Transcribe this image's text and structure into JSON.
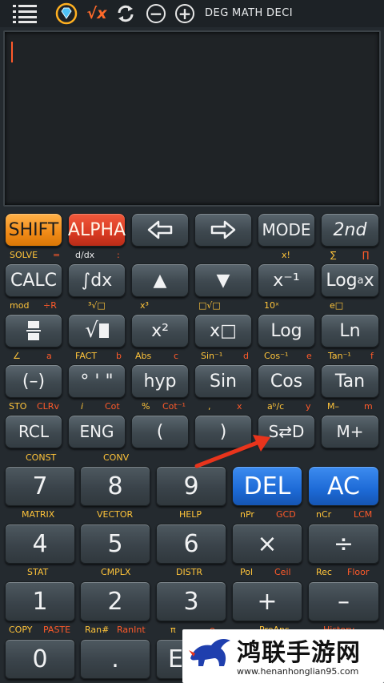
{
  "topbar": {
    "menu_icon": "hamburger-menu-icon",
    "items": [
      "DEG",
      "MATH",
      "DECI"
    ],
    "sqrt_label": "√x"
  },
  "display": {
    "value": ""
  },
  "row1": {
    "shift": "SHIFT",
    "alpha": "ALPHA",
    "mode": "MODE",
    "second": "2nd",
    "labels": [
      "SOLVE",
      "=",
      "d/dx",
      ":",
      "x!",
      "∑",
      "∏"
    ]
  },
  "row2": {
    "calc": "CALC",
    "integral": "∫dx",
    "up": "▲",
    "down": "▼",
    "inverse": "x⁻¹",
    "log_a": "Log",
    "log_a_sub": "a",
    "log_a_tail": "x",
    "labels": [
      "mod",
      "÷R",
      "³√□",
      "x³",
      "□√□",
      "10ˣ",
      "e□"
    ]
  },
  "row3": {
    "fraction": "",
    "sqrt": "√",
    "square": "x²",
    "power": "x□",
    "log": "Log",
    "ln": "Ln",
    "labels": [
      "∠",
      "a",
      "FACT",
      "b",
      "Abs",
      "c",
      "Sin⁻¹",
      "d",
      "Cos⁻¹",
      "e",
      "Tan⁻¹",
      "f"
    ]
  },
  "row4": {
    "neg": "(–)",
    "deg": "° ' \"",
    "hyp": "hyp",
    "sin": "Sin",
    "cos": "Cos",
    "tan": "Tan",
    "labels": [
      "STO",
      "CLRv",
      "i",
      "Cot",
      "%",
      "Cot⁻¹",
      ",",
      "x",
      "aᵇ/c",
      "y",
      "M–",
      "m"
    ]
  },
  "row5": {
    "rcl": "RCL",
    "eng": "ENG",
    "lparen": "(",
    "rparen": ")",
    "sd": "S⇄D",
    "mplus": "M+",
    "labels": [
      "CONST",
      "CONV"
    ]
  },
  "keypad": {
    "r1": [
      "7",
      "8",
      "9",
      "DEL",
      "AC"
    ],
    "r1_labels": [
      "MATRIX",
      "VECTOR",
      "HELP",
      "nPr",
      "GCD",
      "nCr",
      "LCM"
    ],
    "r2": [
      "4",
      "5",
      "6",
      "×",
      "÷"
    ],
    "r2_labels": [
      "STAT",
      "CMPLX",
      "DISTR",
      "Pol",
      "Ceil",
      "Rec",
      "Floor"
    ],
    "r3": [
      "1",
      "2",
      "3",
      "+",
      "–"
    ],
    "r3_labels": [
      "COPY",
      "PASTE",
      "Ran#",
      "RanInt",
      "π",
      "e",
      "PreAns",
      "History"
    ],
    "r4": [
      "0",
      ".",
      "E"
    ]
  },
  "watermark": {
    "title": "鸿联手游网",
    "url": "www.henanhonglian95.com"
  },
  "colors": {
    "shift": "#f08a17",
    "alpha": "#d93a22",
    "blue_keys": "#1d6ad6",
    "label_yellow": "#ffc43a",
    "label_red": "#ff5a2a",
    "arrow": "#e8341c"
  }
}
